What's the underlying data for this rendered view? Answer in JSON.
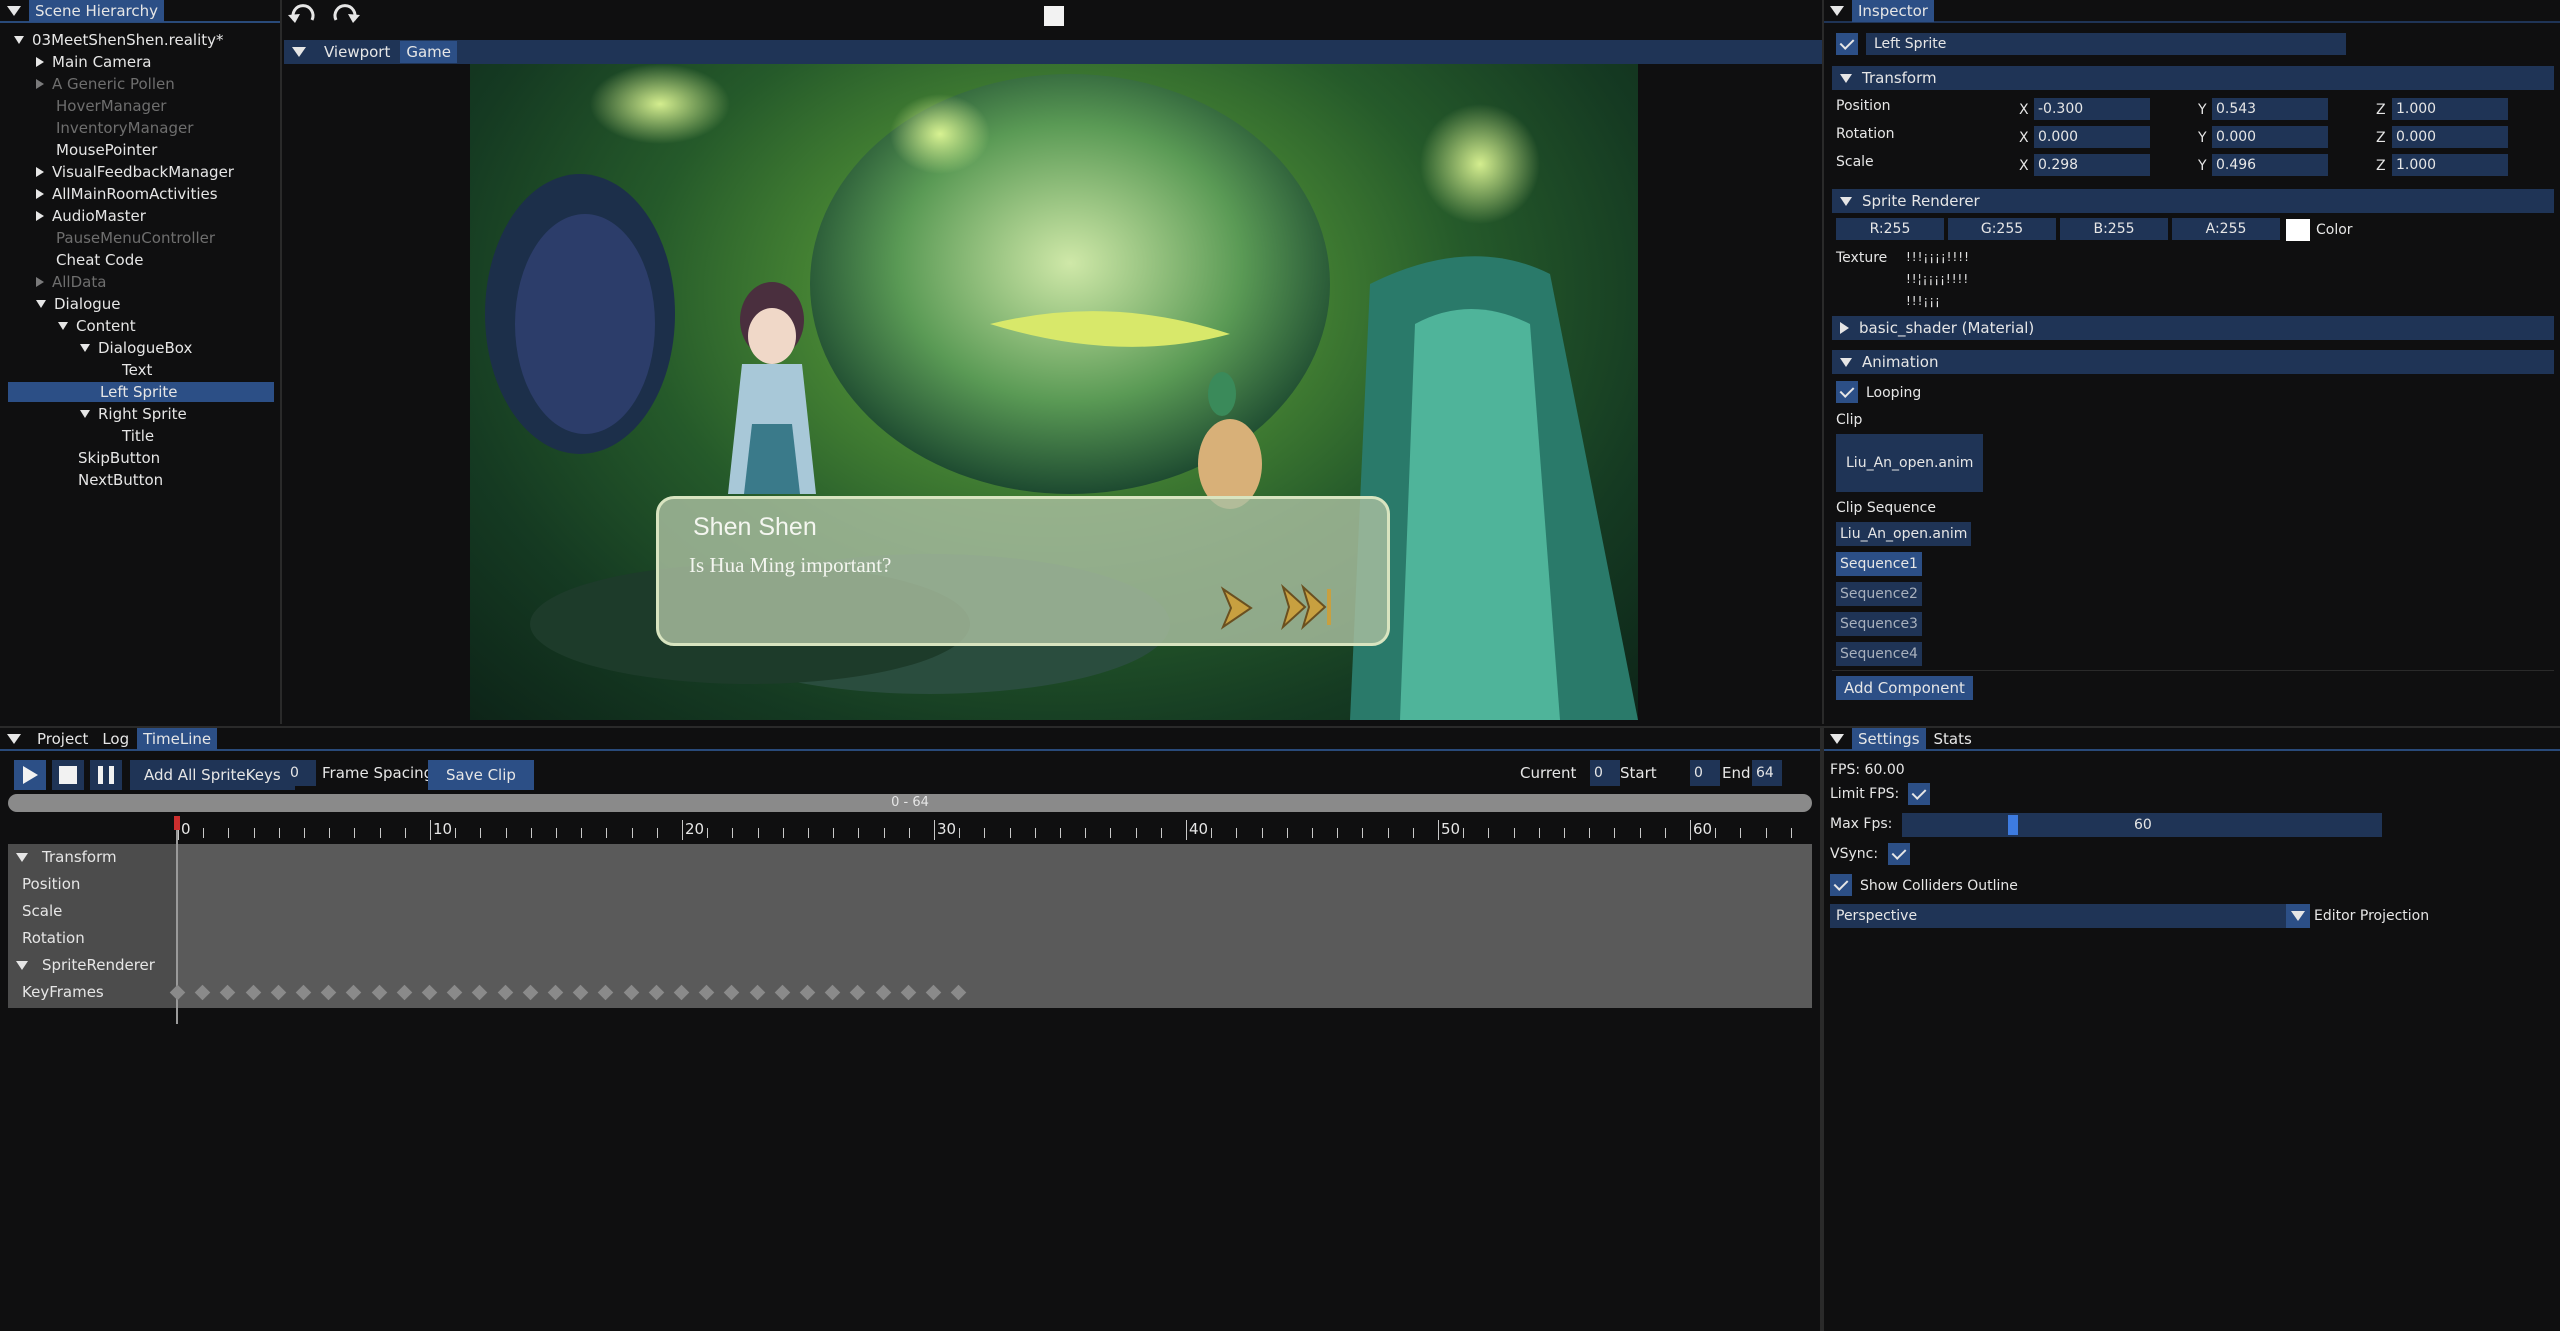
{
  "hierarchy": {
    "tab": "Scene Hierarchy",
    "scene": "03MeetShenShen.reality*",
    "items": [
      {
        "label": "Main Camera",
        "dim": false,
        "arrow": "right",
        "indent": 1
      },
      {
        "label": "A Generic Pollen",
        "dim": true,
        "arrow": "right",
        "indent": 1
      },
      {
        "label": "HoverManager",
        "dim": true,
        "arrow": "",
        "indent": 1
      },
      {
        "label": "InventoryManager",
        "dim": true,
        "arrow": "",
        "indent": 1
      },
      {
        "label": "MousePointer",
        "dim": false,
        "arrow": "",
        "indent": 1
      },
      {
        "label": "VisualFeedbackManager",
        "dim": false,
        "arrow": "right",
        "indent": 1
      },
      {
        "label": "AllMainRoomActivities",
        "dim": false,
        "arrow": "right",
        "indent": 1
      },
      {
        "label": "AudioMaster",
        "dim": false,
        "arrow": "right",
        "indent": 1
      },
      {
        "label": "PauseMenuController",
        "dim": true,
        "arrow": "",
        "indent": 1
      },
      {
        "label": "Cheat Code",
        "dim": false,
        "arrow": "",
        "indent": 1
      },
      {
        "label": "AllData",
        "dim": true,
        "arrow": "right",
        "indent": 1
      },
      {
        "label": "Dialogue",
        "dim": false,
        "arrow": "down",
        "indent": 1
      },
      {
        "label": "Content",
        "dim": false,
        "arrow": "down",
        "indent": 2
      },
      {
        "label": "DialogueBox",
        "dim": false,
        "arrow": "down",
        "indent": 3
      },
      {
        "label": "Text",
        "dim": false,
        "arrow": "",
        "indent": 4
      },
      {
        "label": "Left Sprite",
        "dim": false,
        "arrow": "",
        "indent": 3,
        "selected": true
      },
      {
        "label": "Right Sprite",
        "dim": false,
        "arrow": "down",
        "indent": 3
      },
      {
        "label": "Title",
        "dim": false,
        "arrow": "",
        "indent": 4
      },
      {
        "label": "SkipButton",
        "dim": false,
        "arrow": "",
        "indent": 2
      },
      {
        "label": "NextButton",
        "dim": false,
        "arrow": "",
        "indent": 2
      }
    ]
  },
  "viewport": {
    "tab_viewport": "Viewport",
    "tab_game": "Game",
    "dialogue_name": "Shen Shen",
    "dialogue_text": "Is Hua Ming important?"
  },
  "inspector": {
    "tab": "Inspector",
    "object_name": "Left Sprite",
    "transform": {
      "title": "Transform",
      "position": {
        "label": "Position",
        "x": "-0.300",
        "y": "0.543",
        "z": "1.000"
      },
      "rotation": {
        "label": "Rotation",
        "x": "0.000",
        "y": "0.000",
        "z": "0.000"
      },
      "scale": {
        "label": "Scale",
        "x": "0.298",
        "y": "0.496",
        "z": "1.000"
      },
      "axis_x": "X",
      "axis_y": "Y",
      "axis_z": "Z"
    },
    "sprite_renderer": {
      "title": "Sprite Renderer",
      "r": "R:255",
      "g": "G:255",
      "b": "B:255",
      "a": "A:255",
      "color_label": "Color",
      "texture_label": "Texture",
      "texture_glyphs_1": "!!!¡¡¡¡!!!!",
      "texture_glyphs_2": "!!¦¡¡¡¡!!!!",
      "texture_glyphs_3": "!!!¡¡¡"
    },
    "material": {
      "title": "basic_shader (Material)"
    },
    "animation": {
      "title": "Animation",
      "looping_label": "Looping",
      "clip_label": "Clip",
      "clip_value": "Liu_An_open.anim",
      "clip_sequence_label": "Clip Sequence",
      "sequence": [
        "Liu_An_open.anim",
        "Sequence1",
        "Sequence2",
        "Sequence3",
        "Sequence4"
      ]
    },
    "add_component": "Add Component"
  },
  "timeline": {
    "tab_project": "Project",
    "tab_log": "Log",
    "tab_timeline": "TimeLine",
    "add_all": "Add All SpriteKeys",
    "frame_spacing_value": "0",
    "frame_spacing_label": "Frame Spacing",
    "save_clip": "Save Clip",
    "current_label": "Current",
    "current_value": "0",
    "start_label": "Start",
    "start_value": "0",
    "end_label": "End",
    "end_value": "64",
    "range_label": "0 - 64",
    "ruler_labels": [
      "0",
      "10",
      "20",
      "30",
      "40",
      "50",
      "60"
    ],
    "tracks": [
      {
        "label": "Transform",
        "group": true
      },
      {
        "label": "Position",
        "group": false
      },
      {
        "label": "Scale",
        "group": false
      },
      {
        "label": "Rotation",
        "group": false
      },
      {
        "label": "SpriteRenderer",
        "group": true
      },
      {
        "label": "KeyFrames",
        "group": false
      }
    ],
    "keyframe_count": 32
  },
  "settings": {
    "tab_settings": "Settings",
    "tab_stats": "Stats",
    "fps": "FPS: 60.00",
    "limit_fps_label": "Limit FPS:",
    "max_fps_label": "Max Fps:",
    "max_fps_value": "60",
    "max_fps_fraction": 0.221,
    "vsync_label": "VSync:",
    "show_colliders_label": "Show Colliders Outline",
    "projection_value": "Perspective",
    "projection_label": "Editor Projection"
  },
  "colors": {
    "accent": "#2c4f86",
    "field": "#1f3456",
    "bg": "#0f0f10"
  }
}
